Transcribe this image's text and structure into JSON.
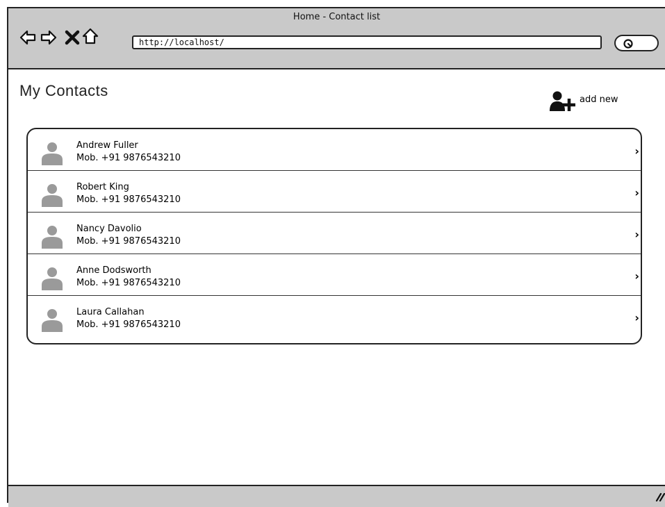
{
  "window": {
    "title": "Home - Contact list"
  },
  "toolbar": {
    "back_icon": "back-arrow-icon",
    "forward_icon": "forward-arrow-icon",
    "stop_icon": "stop-x-icon",
    "home_icon": "home-icon",
    "url": "http://localhost/",
    "search_icon": "search-icon"
  },
  "page": {
    "title": "My Contacts",
    "add_new_label": "add new",
    "add_new_icon": "add-user-icon"
  },
  "contacts": [
    {
      "name": "Andrew Fuller",
      "phone": "Mob. +91 9876543210"
    },
    {
      "name": "Robert King",
      "phone": "Mob. +91 9876543210"
    },
    {
      "name": "Nancy Davolio",
      "phone": "Mob. +91 9876543210"
    },
    {
      "name": "Anne Dodsworth",
      "phone": "Mob. +91 9876543210"
    },
    {
      "name": "Laura Callahan",
      "phone": "Mob. +91 9876543210"
    }
  ],
  "colors": {
    "chrome": "#c9c9c9",
    "border": "#222222",
    "avatar": "#9a9a9a"
  }
}
